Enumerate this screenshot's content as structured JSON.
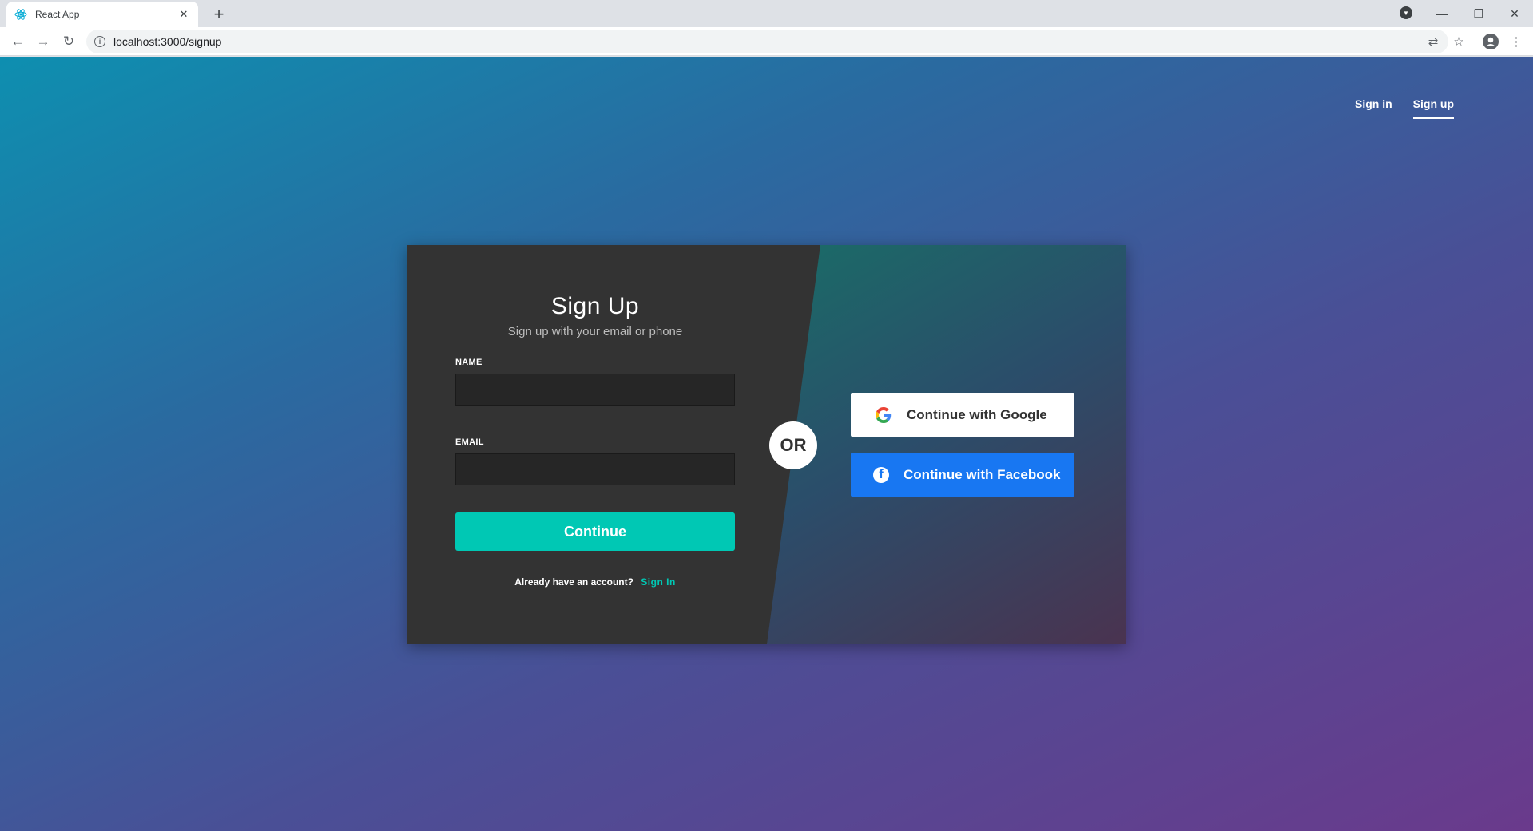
{
  "browser": {
    "tab_title": "React App",
    "url": "localhost:3000/signup"
  },
  "nav": {
    "signin": "Sign in",
    "signup": "Sign up"
  },
  "signup": {
    "title": "Sign Up",
    "subtitle": "Sign up with your email or phone",
    "name_label": "NAME",
    "email_label": "EMAIL",
    "name_value": "",
    "email_value": "",
    "continue": "Continue",
    "already": "Already have an account?",
    "signin_link": "Sign In"
  },
  "or": "OR",
  "social": {
    "google": "Continue with Google",
    "facebook": "Continue with Facebook"
  },
  "colors": {
    "accent": "#00c8b4",
    "facebook": "#1877f2",
    "card": "#333333"
  },
  "icons": [
    "react-icon",
    "close-icon",
    "plus-icon",
    "back-icon",
    "forward-icon",
    "reload-icon",
    "info-icon",
    "translate-icon",
    "star-icon",
    "account-icon",
    "menu-icon",
    "google-icon",
    "facebook-icon"
  ]
}
